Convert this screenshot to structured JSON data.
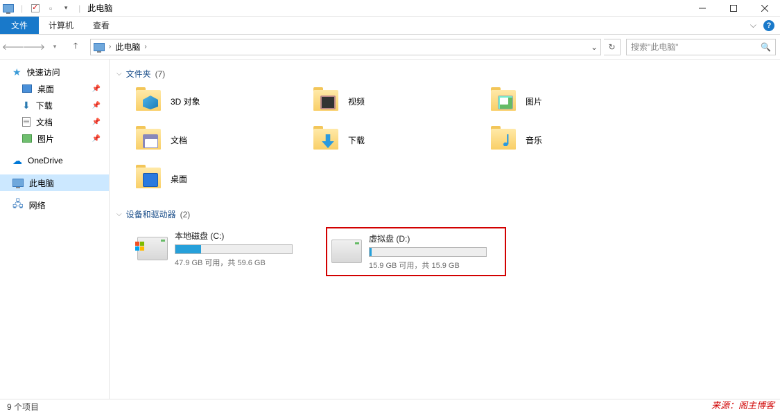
{
  "titlebar": {
    "title": "此电脑"
  },
  "ribbon": {
    "file": "文件",
    "tabs": [
      "计算机",
      "查看"
    ]
  },
  "nav": {
    "location": "此电脑",
    "search_placeholder": "搜索\"此电脑\""
  },
  "sidebar": {
    "quick_access": "快速访问",
    "quick_items": [
      {
        "label": "桌面",
        "pinned": true,
        "icon": "desktop"
      },
      {
        "label": "下载",
        "pinned": true,
        "icon": "downloads"
      },
      {
        "label": "文档",
        "pinned": true,
        "icon": "documents"
      },
      {
        "label": "图片",
        "pinned": true,
        "icon": "pictures"
      }
    ],
    "onedrive": "OneDrive",
    "this_pc": "此电脑",
    "network": "网络"
  },
  "groups": {
    "folders": {
      "label": "文件夹",
      "count": "(7)"
    },
    "drives": {
      "label": "设备和驱动器",
      "count": "(2)"
    }
  },
  "folders": [
    {
      "label": "3D 对象",
      "icon": "3d"
    },
    {
      "label": "视频",
      "icon": "video"
    },
    {
      "label": "图片",
      "icon": "pictures"
    },
    {
      "label": "文档",
      "icon": "documents"
    },
    {
      "label": "下载",
      "icon": "downloads"
    },
    {
      "label": "音乐",
      "icon": "music"
    },
    {
      "label": "桌面",
      "icon": "desktop"
    }
  ],
  "drives": [
    {
      "name": "本地磁盘 (C:)",
      "subtitle": "47.9 GB 可用，共 59.6 GB",
      "fill_pct": 22,
      "highlighted": false,
      "winlogo": true
    },
    {
      "name": "虚拟盘 (D:)",
      "subtitle": "15.9 GB 可用，共 15.9 GB",
      "fill_pct": 2,
      "highlighted": true,
      "winlogo": false
    }
  ],
  "status": {
    "items": "9 个项目"
  },
  "watermark": "来源：阁主博客"
}
